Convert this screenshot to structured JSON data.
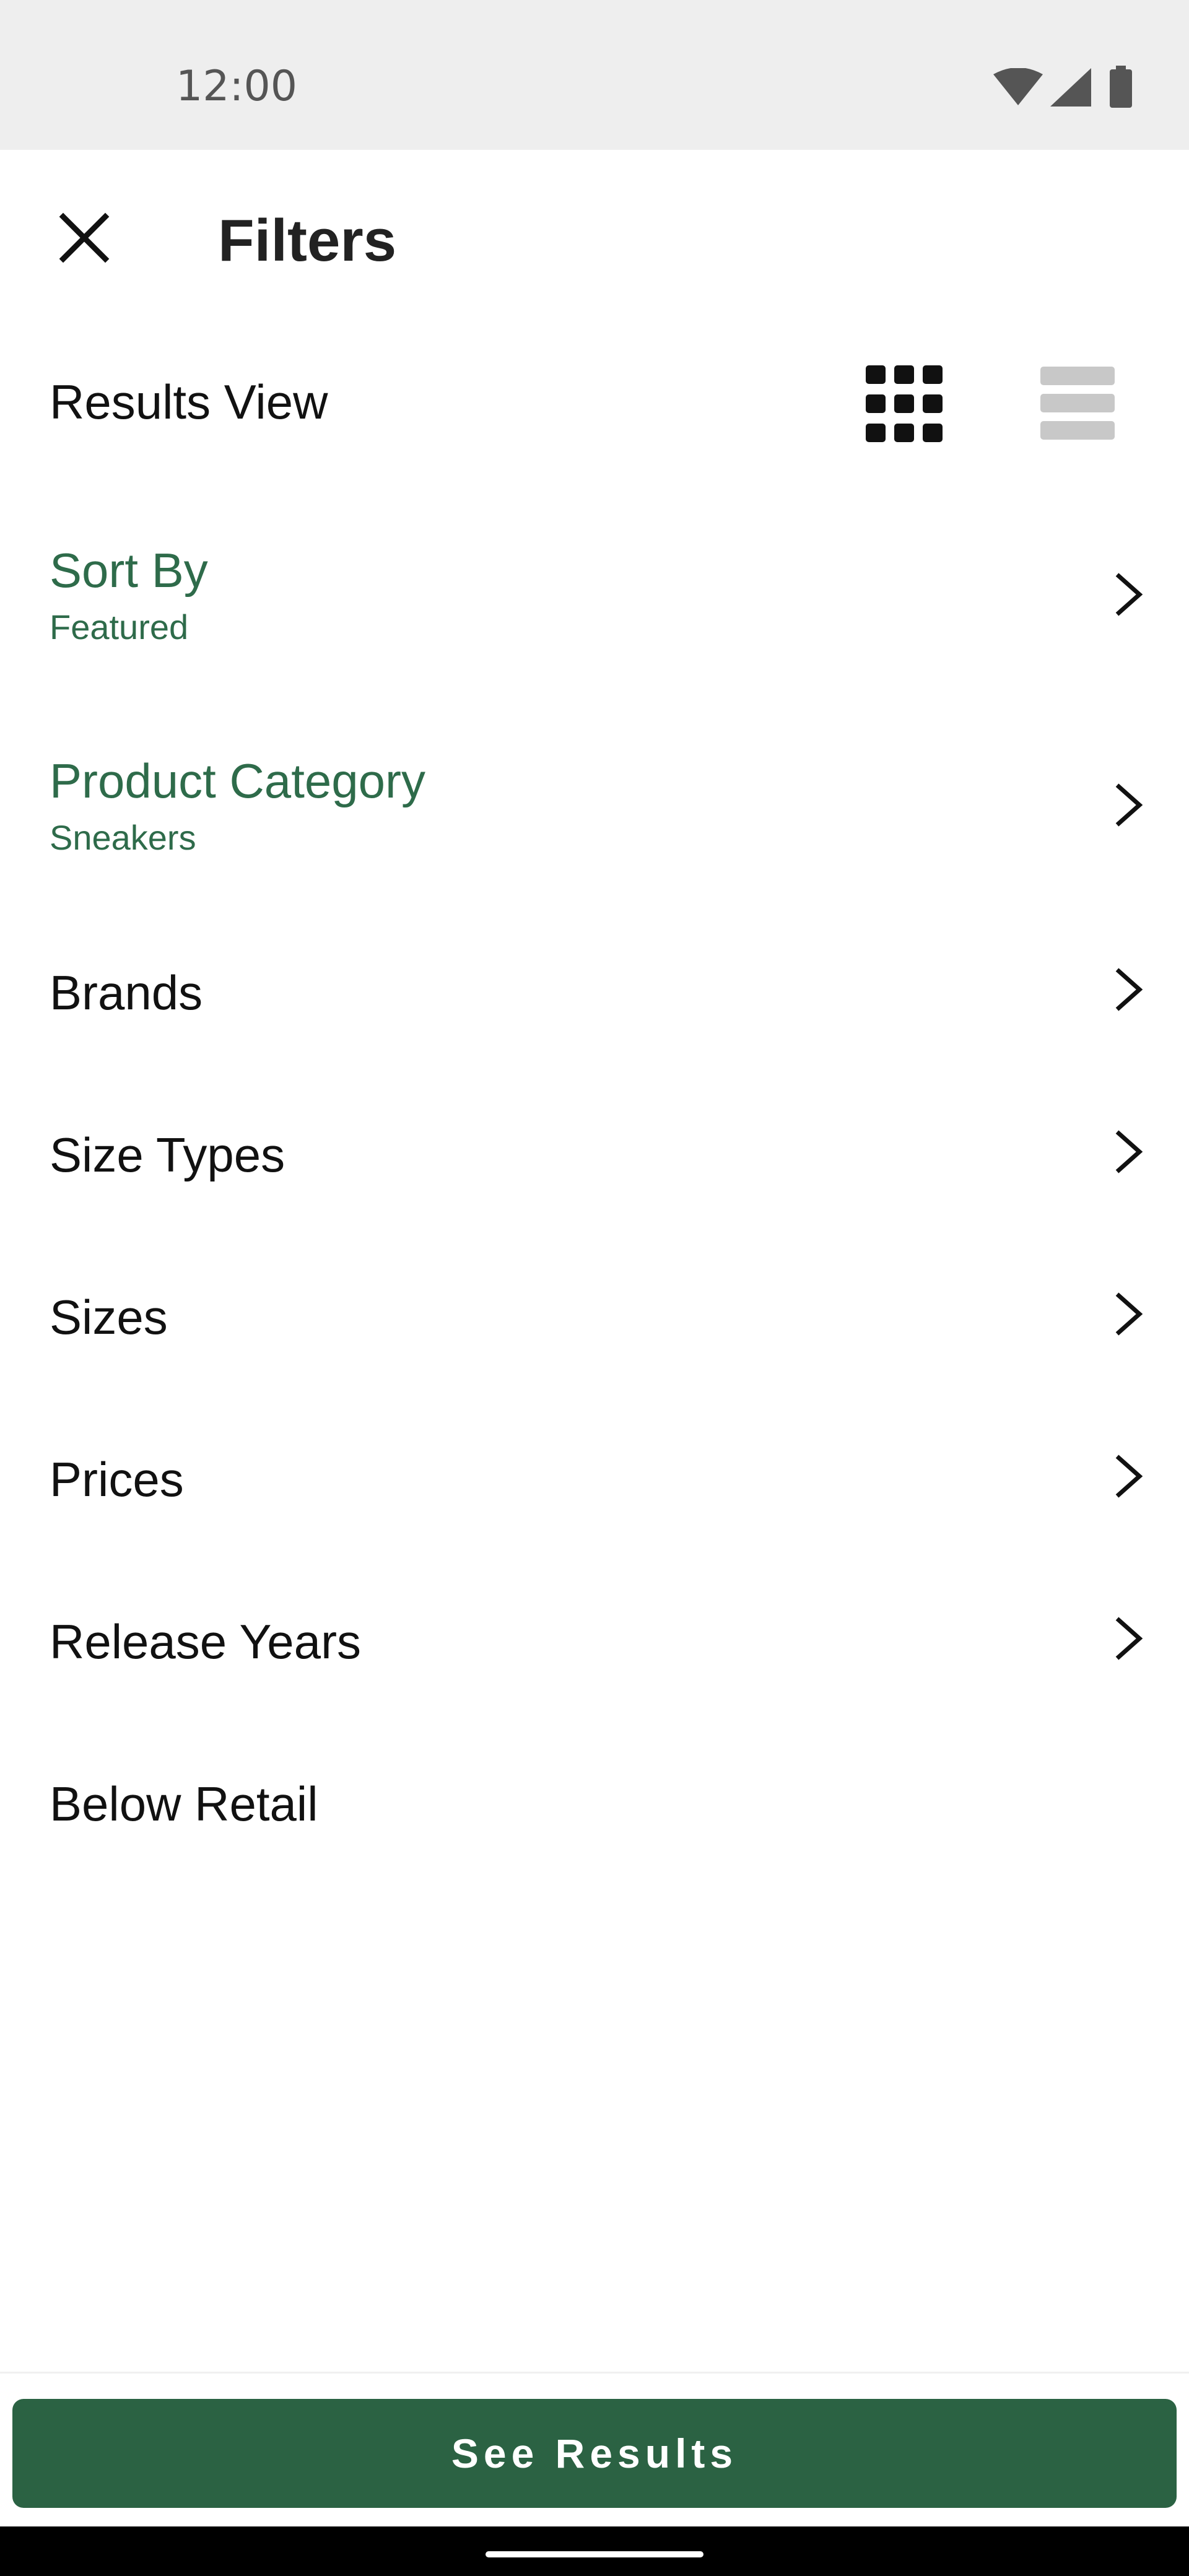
{
  "status_bar": {
    "time": "12:00",
    "icons": [
      "wifi-icon",
      "signal-icon",
      "battery-icon"
    ]
  },
  "header": {
    "title": "Filters",
    "close_icon": "close-icon"
  },
  "results_view": {
    "label": "Results View",
    "grid_icon": "grid-view-icon",
    "list_icon": "list-view-icon",
    "active": "grid"
  },
  "filters": {
    "sort_by": {
      "label": "Sort By",
      "value": "Featured"
    },
    "product_category": {
      "label": "Product Category",
      "value": "Sneakers"
    },
    "brands": {
      "label": "Brands"
    },
    "size_types": {
      "label": "Size Types"
    },
    "sizes": {
      "label": "Sizes"
    },
    "prices": {
      "label": "Prices"
    },
    "release_years": {
      "label": "Release Years"
    },
    "below_retail": {
      "label": "Below Retail"
    }
  },
  "cta": {
    "label": "See Results"
  },
  "colors": {
    "accent": "#2e6b4a",
    "button": "#2b6243",
    "status_bar": "#eeeeee"
  }
}
